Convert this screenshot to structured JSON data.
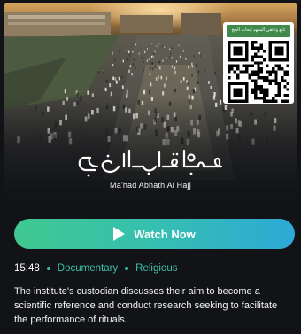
{
  "hero": {
    "qr_caption": "تابع وثائقي المعهد أبحاث الحج",
    "logo_arabic": "معهد أبحاث الحج",
    "logo_english": "Ma'had Abhath Al Hajj"
  },
  "actions": {
    "watch_label": "Watch Now"
  },
  "meta": {
    "duration": "15:48",
    "genres": [
      "Documentary",
      "Religious"
    ]
  },
  "description": "The institute's custodian discusses their aim to become a scientific reference and conduct research seeking to facilitate the performance of rituals.",
  "colors": {
    "accent": "#3ec0a8",
    "button_gradient_start": "#40c88f",
    "button_gradient_end": "#2ea9d7",
    "background": "#111317"
  },
  "icons": {
    "play": "play-icon",
    "qr": "qr-code-icon"
  }
}
